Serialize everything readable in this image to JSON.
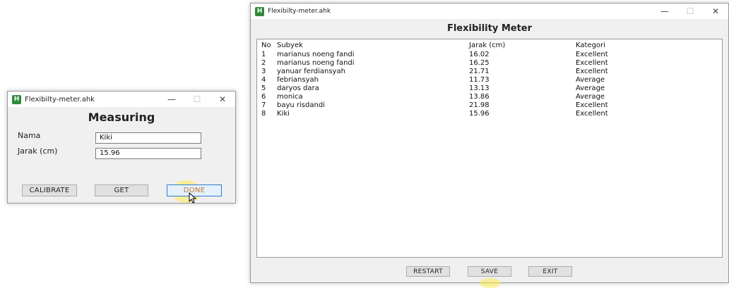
{
  "measure_window": {
    "title": "Flexibilty-meter.ahk",
    "heading": "Measuring",
    "fields": [
      {
        "label": "Nama",
        "value": "Kiki"
      },
      {
        "label": "Jarak (cm)",
        "value": "15.96"
      }
    ],
    "buttons": {
      "calibrate": "CALIBRATE",
      "get": "GET",
      "done": "DONE"
    },
    "controls": {
      "minimize": "—",
      "maximize": "☐",
      "close": "✕"
    }
  },
  "results_window": {
    "title": "Flexibilty-meter.ahk",
    "heading": "Flexibility Meter",
    "columns": [
      "No",
      "Subyek",
      "Jarak (cm)",
      "Kategori"
    ],
    "rows": [
      [
        "1",
        "marianus noeng fandi",
        "16.02",
        "Excellent"
      ],
      [
        "2",
        "marianus noeng fandi",
        "16.25",
        "Excellent"
      ],
      [
        "3",
        "yanuar ferdiansyah",
        "21.71",
        "Excellent"
      ],
      [
        "4",
        "febriansyah",
        "11.73",
        "Average"
      ],
      [
        "5",
        "daryos dara",
        "13.13",
        "Average"
      ],
      [
        "6",
        "monica",
        "13.86",
        "Average"
      ],
      [
        "7",
        "bayu risdandi",
        "21.98",
        "Excellent"
      ],
      [
        "8",
        "Kiki",
        "15.96",
        "Excellent"
      ]
    ],
    "buttons": {
      "restart": "RESTART",
      "save": "SAVE",
      "exit": "EXIT"
    },
    "controls": {
      "minimize": "—",
      "maximize": "☐",
      "close": "✕"
    }
  },
  "icons": {
    "app": "H"
  }
}
